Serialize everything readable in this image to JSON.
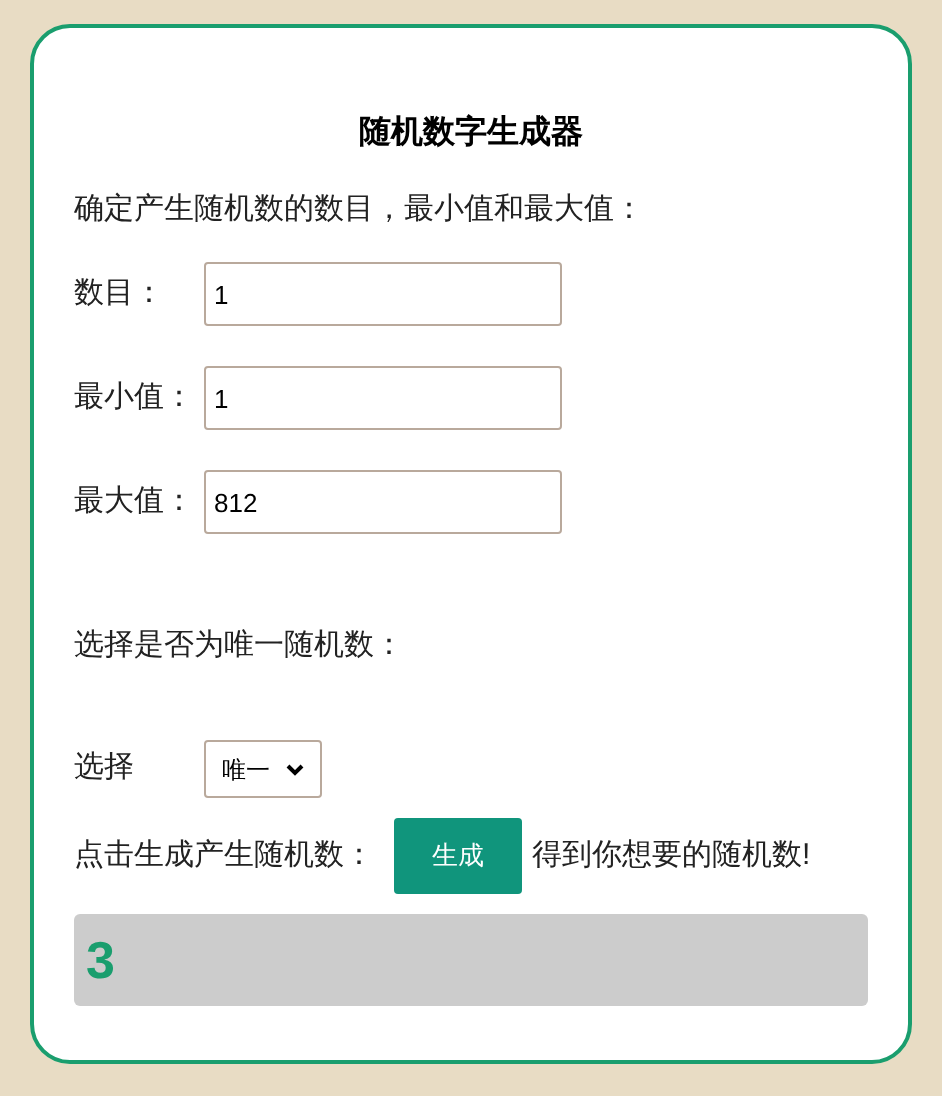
{
  "title": "随机数字生成器",
  "intro": "确定产生随机数的数目，最小值和最大值：",
  "fields": [
    {
      "label": "数目：",
      "value": "1"
    },
    {
      "label": "最小值：",
      "value": "1"
    },
    {
      "label": "最大值：",
      "value": "812"
    }
  ],
  "unique_prompt": "选择是否为唯一随机数：",
  "select": {
    "label": "选择",
    "value": "唯一"
  },
  "generate": {
    "before": "点击生成产生随机数：",
    "button": "生成",
    "after": "得到你想要的随机数!"
  },
  "result": "3"
}
